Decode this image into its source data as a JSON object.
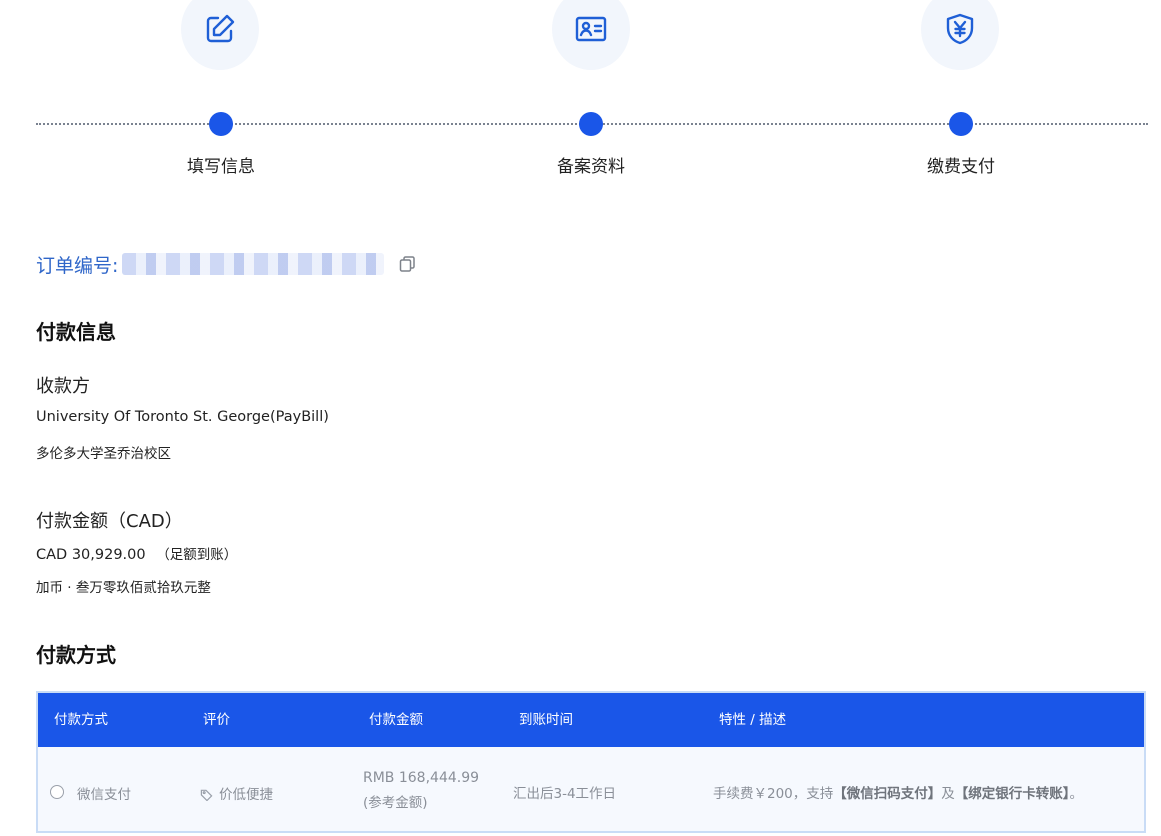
{
  "steps": [
    {
      "label": "填写信息",
      "icon": "edit-icon"
    },
    {
      "label": "备案资料",
      "icon": "id-card-icon"
    },
    {
      "label": "缴费支付",
      "icon": "yuan-shield-icon"
    }
  ],
  "order": {
    "label": "订单编号:"
  },
  "payment_info": {
    "title": "付款信息",
    "payee_label": "收款方",
    "payee_name_en": "University Of Toronto St. George(PayBill)",
    "payee_name_cn": "多伦多大学圣乔治校区",
    "amount_label": "付款金额（CAD）",
    "amount_value": "CAD 30,929.00",
    "amount_note": "（足额到账）",
    "amount_words": "加币 · 叁万零玖佰贰拾玖元整"
  },
  "payment_method": {
    "title": "付款方式",
    "columns": [
      "付款方式",
      "评价",
      "付款金额",
      "到账时间",
      "特性 / 描述"
    ],
    "rows": [
      {
        "method": "微信支付",
        "rating": "价低便捷",
        "amount": "RMB 168,444.99",
        "amount_note": "(参考金额)",
        "arrival": "汇出后3-4工作日",
        "desc_prefix": "手续费￥200，支持",
        "desc_b1": "【微信扫码支付】",
        "desc_mid": "及",
        "desc_b2": "【绑定银行卡转账】",
        "desc_suffix": "。"
      }
    ]
  },
  "colors": {
    "accent": "#1a56e8",
    "link": "#2f66c9",
    "border": "#c9dcf6"
  }
}
